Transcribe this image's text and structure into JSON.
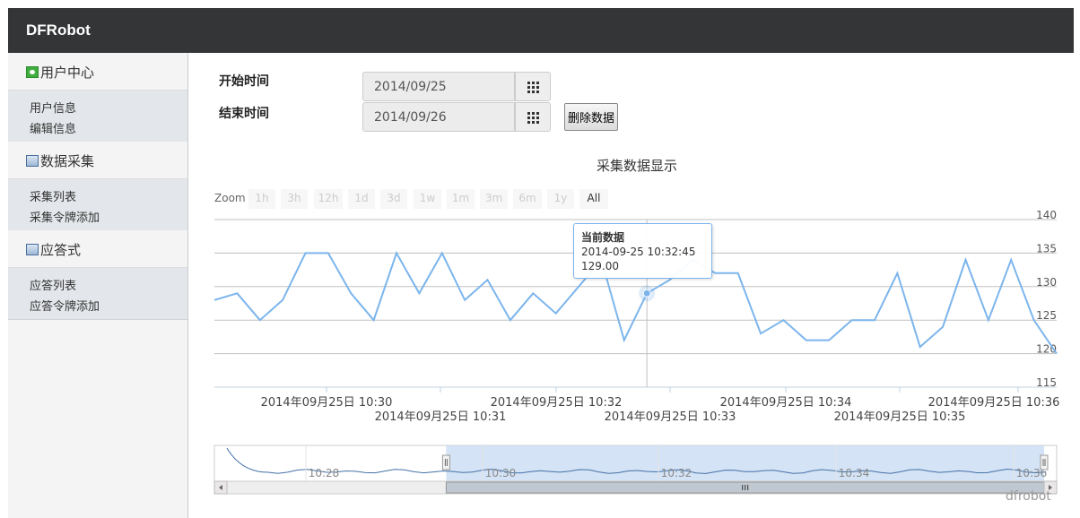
{
  "app": {
    "brand": "DFRobot"
  },
  "sidebar": {
    "sections": [
      {
        "title": "用户中心",
        "icon": "user-center-icon",
        "items": [
          "用户信息",
          "编辑信息"
        ]
      },
      {
        "title": "数据采集",
        "icon": "monitor-icon",
        "items": [
          "采集列表",
          "采集令牌添加"
        ]
      },
      {
        "title": "应答式",
        "icon": "monitor-icon",
        "items": [
          "应答列表",
          "应答令牌添加"
        ]
      }
    ]
  },
  "filters": {
    "start_label": "开始时间",
    "start_value": "2014/09/25",
    "end_label": "结束时间",
    "end_value": "2014/09/26",
    "calendar_icon": "calendar-grid-icon",
    "delete_label": "删除数据"
  },
  "chart_data": {
    "type": "line",
    "title": "采集数据显示",
    "zoom": {
      "label": "Zoom",
      "buttons": [
        "1h",
        "3h",
        "12h",
        "1d",
        "3d",
        "1w",
        "1m",
        "3m",
        "6m",
        "1y",
        "All"
      ],
      "active": "All"
    },
    "y_axis": {
      "ticks": [
        115,
        120,
        125,
        130,
        135,
        140
      ],
      "ylim": [
        115,
        140
      ],
      "position": "right"
    },
    "x_axis": {
      "upper_labels": [
        "2014年09月25日 10:30",
        "2014年09月25日 10:32",
        "2014年09月25日 10:34",
        "2014年09月25日 10:36"
      ],
      "lower_labels": [
        "2014年09月25日 10:31",
        "2014年09月25日 10:33",
        "2014年09月25日 10:35"
      ]
    },
    "series": [
      {
        "color": "#7cb5ec",
        "values": [
          128,
          129,
          125,
          128,
          135,
          135,
          129,
          125,
          135,
          129,
          135,
          128,
          131,
          125,
          129,
          126,
          130,
          134,
          122,
          129,
          131,
          134,
          132,
          132,
          123,
          125,
          122,
          122,
          125,
          125,
          132,
          121,
          124,
          134,
          125,
          134,
          125,
          120
        ]
      }
    ],
    "tooltip": {
      "title": "当前数据",
      "time": "2014-09-25 10:32:45",
      "value": "129.00",
      "index": 19
    },
    "navigator": {
      "labels": [
        "10:28",
        "10:30",
        "10:32",
        "10:34",
        "10:36"
      ],
      "selection_fraction": [
        0.2778,
        1.0
      ]
    },
    "credit": "dfrobot"
  }
}
